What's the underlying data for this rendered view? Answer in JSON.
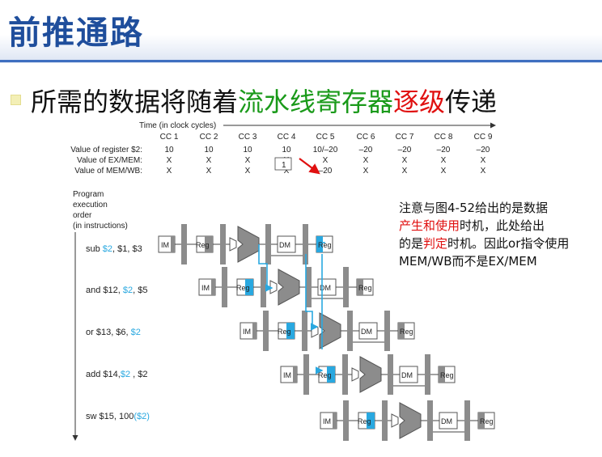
{
  "title": "前推通路",
  "bullet": {
    "part1": "所需的数据将随着",
    "part2_green": "流水线寄存器",
    "part3_red": "逐级",
    "part4": "传递"
  },
  "timing": {
    "axis_label": "Time (in clock cycles)",
    "cycles": [
      "CC 1",
      "CC 2",
      "CC 3",
      "CC 4",
      "CC 5",
      "CC 6",
      "CC 7",
      "CC 8",
      "CC 9"
    ],
    "rows": [
      {
        "label": "Value of register $2:",
        "values": [
          "10",
          "10",
          "10",
          "10",
          "10/–20",
          "–20",
          "–20",
          "–20",
          "–20"
        ]
      },
      {
        "label": "Value of EX/MEM:",
        "values": [
          "X",
          "X",
          "X",
          "X",
          "X",
          "X",
          "X",
          "X",
          "X"
        ]
      },
      {
        "label": "Value of MEM/WB:",
        "values": [
          "X",
          "X",
          "X",
          "X",
          "–20",
          "X",
          "X",
          "X",
          "X"
        ]
      }
    ],
    "marker": "1"
  },
  "program": {
    "header": [
      "Program",
      "execution",
      "order",
      "(in instructions)"
    ],
    "instructions": [
      {
        "pre": "sub ",
        "hl": "$2",
        "post": ", $1, $3"
      },
      {
        "pre": "and $12, ",
        "hl": "$2",
        "post": ", $5"
      },
      {
        "pre": "or $13, $6, ",
        "hl": "$2",
        "post": ""
      },
      {
        "pre": "add $14,",
        "hl": "$2",
        "post": " , $2"
      },
      {
        "pre": "sw $15, 100",
        "hl": "($2)",
        "post": ""
      }
    ]
  },
  "stage_labels": {
    "im": "IM",
    "reg": "Reg",
    "dm": "DM"
  },
  "note": {
    "line1": "注意与图4-52给出的是数据",
    "red1": "产生和使用",
    "line2b": "时机，此处给出",
    "line3a": "的是",
    "red2": "判定",
    "line3b": "时机。因此or指令使用MEM/WB而不是EX/MEM"
  },
  "colors": {
    "title": "#1f4e9c",
    "green": "#1a9a1a",
    "red": "#e01010",
    "highlight": "#29a8e0",
    "unit": "#8c8c8c"
  }
}
